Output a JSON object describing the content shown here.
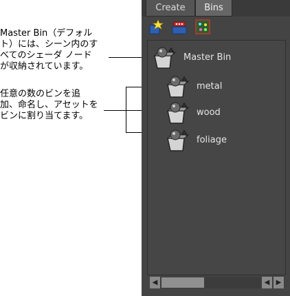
{
  "callouts": {
    "master_bin_note": "Master Bin（デフォル\nト）には、シーン内のす\nべてのシェーダ ノード\nが収納されています。",
    "bins_note": "任意の数のビンを追\n加、命名し、アセットを\nビンに割り当てます。"
  },
  "tabs": [
    {
      "label": "Create"
    },
    {
      "label": "Bins"
    }
  ],
  "toolbar": {
    "icons": [
      "new-bin-icon",
      "bin-options-icon",
      "nodes-icon"
    ]
  },
  "bins": [
    {
      "label": "Master Bin"
    },
    {
      "label": "metal"
    },
    {
      "label": "wood"
    },
    {
      "label": "foliage"
    }
  ],
  "colors": {
    "panel": "#444444",
    "text": "#e6e6e6",
    "bin_box": "#cfcfcf",
    "sphere": "#6b6b6b"
  },
  "scrollbar": {
    "left_arrow": "◀",
    "right_arrow": "▶"
  }
}
